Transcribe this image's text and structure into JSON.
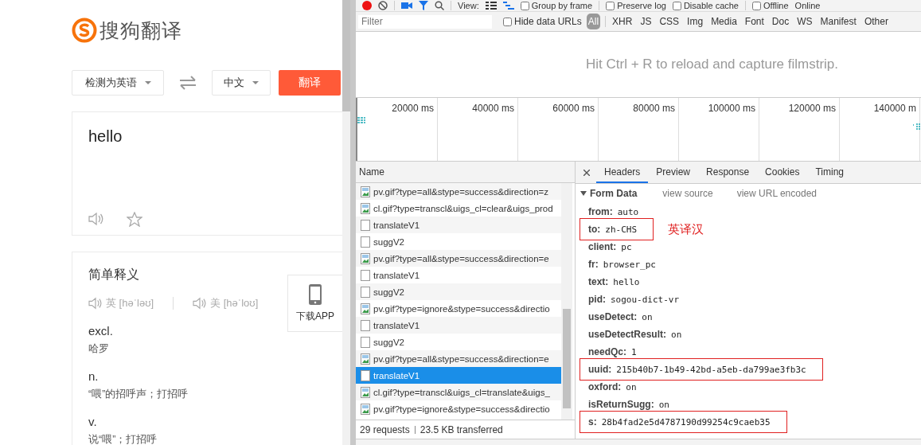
{
  "translator": {
    "logo_text": "搜狗翻译",
    "source_lang": "检测为英语",
    "target_lang": "中文",
    "translate_button": "翻译",
    "input_text": "hello",
    "dictionary": {
      "title": "简单释义",
      "pronunciations": [
        "英 [həˈləʊ]",
        "美 [həˈloʊ]"
      ],
      "senses": [
        {
          "pos": "excl.",
          "meaning": "哈罗"
        },
        {
          "pos": "n.",
          "meaning": "“喂”的招呼声；打招呼"
        },
        {
          "pos": "v.",
          "meaning": "说“喂”；打招呼"
        }
      ]
    },
    "app_download": "下载APP"
  },
  "devtools": {
    "toolbar": {
      "view_label": "View:",
      "checkboxes": [
        {
          "label": "Group by frame",
          "checked": false
        },
        {
          "label": "Preserve log",
          "checked": false
        },
        {
          "label": "Disable cache",
          "checked": false
        },
        {
          "label": "Offline",
          "checked": false
        }
      ],
      "throttle": "Online"
    },
    "filter": {
      "placeholder": "Filter"
    },
    "hide_data_urls": {
      "label": "Hide data URLs",
      "checked": false
    },
    "type_filters": [
      {
        "label": "All",
        "selected": true
      },
      {
        "label": "XHR",
        "selected": false
      },
      {
        "label": "JS",
        "selected": false
      },
      {
        "label": "CSS",
        "selected": false
      },
      {
        "label": "Img",
        "selected": false
      },
      {
        "label": "Media",
        "selected": false
      },
      {
        "label": "Font",
        "selected": false
      },
      {
        "label": "Doc",
        "selected": false
      },
      {
        "label": "WS",
        "selected": false
      },
      {
        "label": "Manifest",
        "selected": false
      },
      {
        "label": "Other",
        "selected": false
      }
    ],
    "filmstrip_hint": "Hit Ctrl + R to reload and capture filmstrip.",
    "timeline_ticks": [
      "20000 ms",
      "40000 ms",
      "60000 ms",
      "80000 ms",
      "100000 ms",
      "120000 ms",
      "140000 m"
    ],
    "requests": {
      "column": "Name",
      "rows": [
        {
          "name": "pv.gif?type=all&stype=success&direction=z",
          "kind": "image",
          "selected": false
        },
        {
          "name": "cl.gif?type=transcl&uigs_cl=clear&uigs_prod",
          "kind": "image",
          "selected": false
        },
        {
          "name": "translateV1",
          "kind": "document",
          "selected": false
        },
        {
          "name": "suggV2",
          "kind": "document",
          "selected": false
        },
        {
          "name": "pv.gif?type=all&stype=success&direction=e",
          "kind": "image",
          "selected": false
        },
        {
          "name": "translateV1",
          "kind": "document",
          "selected": false
        },
        {
          "name": "suggV2",
          "kind": "document",
          "selected": false
        },
        {
          "name": "pv.gif?type=ignore&stype=success&directio",
          "kind": "image",
          "selected": false
        },
        {
          "name": "translateV1",
          "kind": "document",
          "selected": false
        },
        {
          "name": "suggV2",
          "kind": "document",
          "selected": false
        },
        {
          "name": "pv.gif?type=all&stype=success&direction=e",
          "kind": "image",
          "selected": false
        },
        {
          "name": "translateV1",
          "kind": "document",
          "selected": true
        },
        {
          "name": "cl.gif?type=transcl&uigs_cl=translate&uigs_",
          "kind": "image",
          "selected": false
        },
        {
          "name": "pv.gif?type=ignore&stype=success&directio",
          "kind": "image",
          "selected": false
        }
      ]
    },
    "summary": {
      "requests": "29 requests",
      "transferred": "23.5 KB transferred"
    },
    "detail_tabs": [
      {
        "label": "Headers",
        "selected": true
      },
      {
        "label": "Preview",
        "selected": false
      },
      {
        "label": "Response",
        "selected": false
      },
      {
        "label": "Cookies",
        "selected": false
      },
      {
        "label": "Timing",
        "selected": false
      }
    ],
    "form_data": {
      "title": "Form Data",
      "links": [
        "view source",
        "view URL encoded"
      ],
      "params": [
        {
          "key": "from:",
          "value": "auto",
          "highlighted": false
        },
        {
          "key": "to:",
          "value": "zh-CHS",
          "highlighted": true,
          "note": "英译汉"
        },
        {
          "key": "client:",
          "value": "pc",
          "highlighted": false
        },
        {
          "key": "fr:",
          "value": "browser_pc",
          "highlighted": false
        },
        {
          "key": "text:",
          "value": "hello",
          "highlighted": false
        },
        {
          "key": "pid:",
          "value": "sogou-dict-vr",
          "highlighted": false
        },
        {
          "key": "useDetect:",
          "value": "on",
          "highlighted": false
        },
        {
          "key": "useDetectResult:",
          "value": "on",
          "highlighted": false
        },
        {
          "key": "needQc:",
          "value": "1",
          "highlighted": false
        },
        {
          "key": "uuid:",
          "value": "215b40b7-1b49-42bd-a5eb-da799ae3fb3c",
          "highlighted": true
        },
        {
          "key": "oxford:",
          "value": "on",
          "highlighted": false
        },
        {
          "key": "isReturnSugg:",
          "value": "on",
          "highlighted": false
        },
        {
          "key": "s:",
          "value": "28b4fad2e5d4787190d99254c9caeb35",
          "highlighted": true
        }
      ]
    }
  }
}
